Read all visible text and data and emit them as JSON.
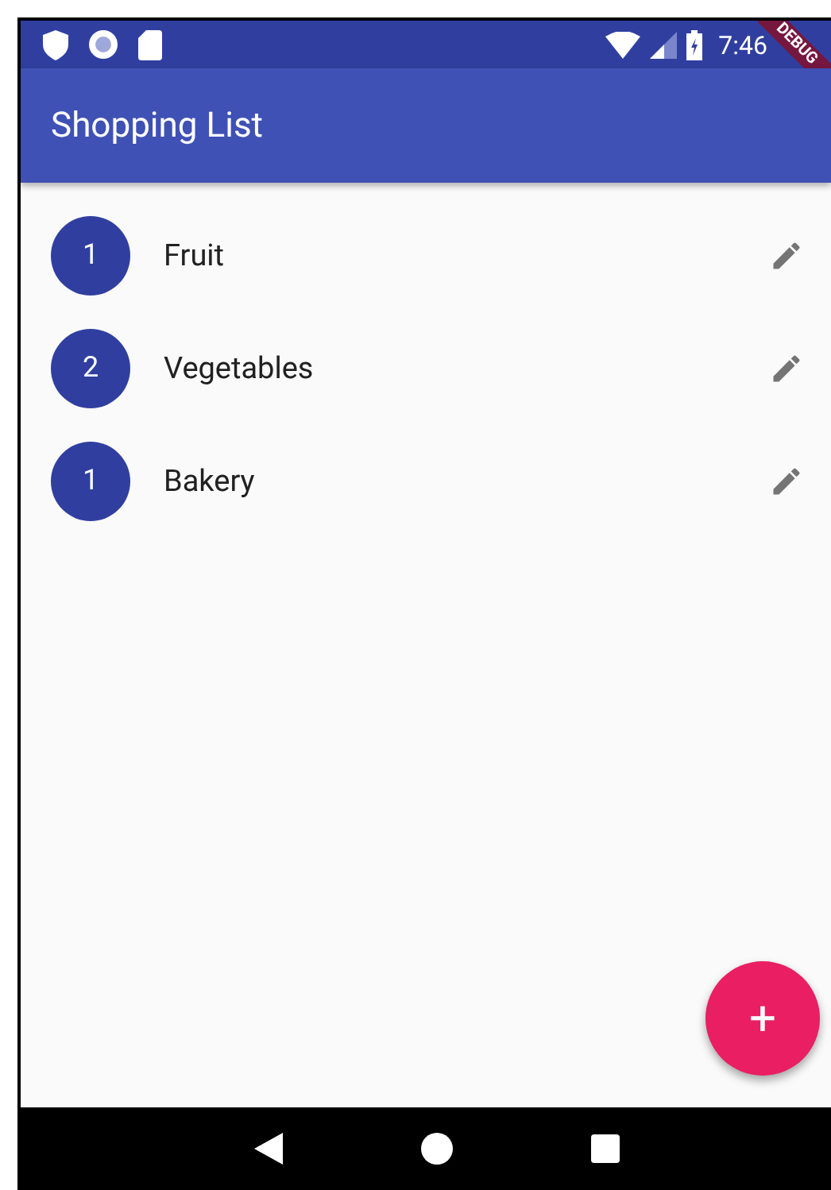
{
  "status_bar": {
    "time": "7:46"
  },
  "debug_banner": {
    "label": "DEBUG"
  },
  "app_bar": {
    "title": "Shopping List"
  },
  "items": [
    {
      "count": "1",
      "name": "Fruit"
    },
    {
      "count": "2",
      "name": "Vegetables"
    },
    {
      "count": "1",
      "name": "Bakery"
    }
  ],
  "fab": {
    "label": "+"
  }
}
